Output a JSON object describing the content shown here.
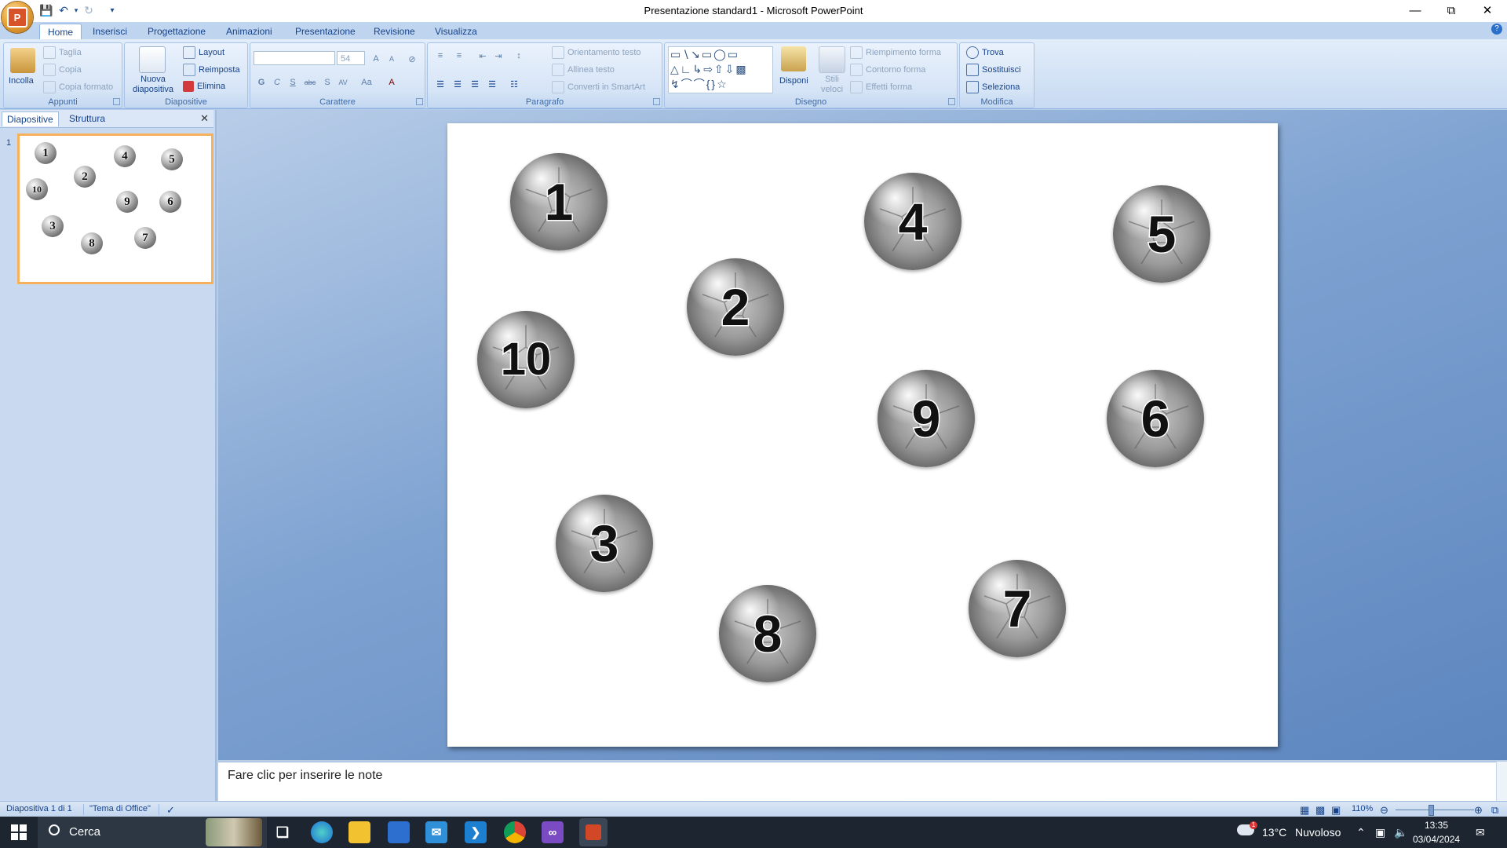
{
  "window": {
    "title": "Presentazione standard1 - Microsoft PowerPoint",
    "controls": [
      "minimize",
      "restore",
      "close"
    ]
  },
  "ribbon": {
    "tabs": [
      "Home",
      "Inserisci",
      "Progettazione",
      "Animazioni",
      "Presentazione",
      "Revisione",
      "Visualizza"
    ],
    "active_tab": "Home",
    "groups": {
      "appunti": {
        "label": "Appunti",
        "incolla": "Incolla",
        "taglia": "Taglia",
        "copia": "Copia",
        "copia_formato": "Copia formato"
      },
      "diapositive": {
        "label": "Diapositive",
        "nuova": "Nuova diapositiva",
        "layout": "Layout",
        "reimposta": "Reimposta",
        "elimina": "Elimina"
      },
      "carattere": {
        "label": "Carattere",
        "font_name": "",
        "font_size": "54"
      },
      "paragrafo": {
        "label": "Paragrafo",
        "orientamento": "Orientamento testo",
        "allinea": "Allinea testo",
        "converti": "Converti in SmartArt"
      },
      "disegno": {
        "label": "Disegno",
        "disponi": "Disponi",
        "stili": "Stili veloci",
        "riempimento": "Riempimento forma",
        "contorno": "Contorno forma",
        "effetti": "Effetti forma"
      },
      "modifica": {
        "label": "Modifica",
        "trova": "Trova",
        "sostituisci": "Sostituisci",
        "seleziona": "Seleziona"
      }
    }
  },
  "left_panel": {
    "tabs": [
      "Diapositive",
      "Struttura"
    ],
    "active_tab": "Diapositive",
    "slide_number": "1"
  },
  "slide": {
    "balls": [
      {
        "label": "1"
      },
      {
        "label": "4"
      },
      {
        "label": "5"
      },
      {
        "label": "2"
      },
      {
        "label": "10"
      },
      {
        "label": "9"
      },
      {
        "label": "6"
      },
      {
        "label": "3"
      },
      {
        "label": "8"
      },
      {
        "label": "7"
      }
    ]
  },
  "notes": {
    "placeholder": "Fare clic per inserire le note"
  },
  "statusbar": {
    "slide_info": "Diapositiva 1 di 1",
    "theme": "\"Tema di Office\"",
    "zoom": "110%"
  },
  "taskbar": {
    "search": "Cerca",
    "weather_temp": "13°C",
    "weather_text": "Nuvoloso",
    "time": "13:35",
    "date": "03/04/2024",
    "weather_badge": "1"
  }
}
